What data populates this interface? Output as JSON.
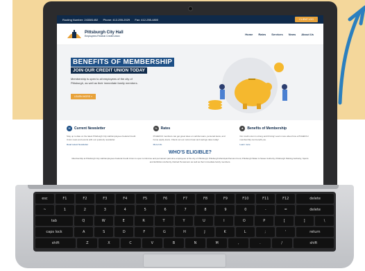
{
  "site": {
    "topbar": {
      "routing": "Routing Number: 243381452",
      "phone": "Phone: 412-255-2029",
      "fax": "Fax: 412-255-4800",
      "login_label": "CLIENT LOG"
    },
    "logo": {
      "line1": "Pittsburgh City Hall",
      "line2": "Employees Federal Credit Union"
    },
    "menu": [
      "Home",
      "Rates",
      "Services",
      "News",
      "About Us"
    ],
    "hero": {
      "title": "BENEFITS OF MEMBERSHIP",
      "subtitle": "JOIN OUR CREDIT UNION TODAY",
      "text": "Membership is open to all employees of the city of Pittsburgh, as well as their immediate family members.",
      "button": "LEARN MORE »"
    },
    "features": [
      {
        "icon": "newsletter-icon",
        "title": "Current Newsletter",
        "text": "Stay up to date on the latest Pittsburgh City Hall Employees Federal Credit Union news and events with our quarterly newsletter.",
        "link": "Read Latest Newsletter"
      },
      {
        "icon": "percent-icon",
        "title": "Rates",
        "text": "PCHEFCU members can get great rates on vehicle loans, personal loans, and home equity loans. Check out our current loan and savings rates today!",
        "link": "More Info"
      },
      {
        "icon": "membership-icon",
        "title": "Benefits of Membership",
        "text": "Our credit union is strong and thriving! Learn more about how a PCHEFCU membership can benefit you.",
        "link": "Learn more"
      }
    ],
    "eligible": {
      "title": "WHO'S ELIGIBLE?",
      "text": "Membership at Pittsburgh City Hall Employees Federal Credit Union is open to full-time and permanent part-time employees of the city of Pittsburgh, Pittsburgh Municipal Pension Fund, Pittsburgh Water & Sewer Authority, Pittsburgh Parking Authority, Sports and Exhibition Authority, Retired Pensioners as well as their immediate family members."
    }
  },
  "keyboard": {
    "row1": [
      "esc",
      "F1",
      "F2",
      "F3",
      "F4",
      "F5",
      "F6",
      "F7",
      "F8",
      "F9",
      "F10",
      "F11",
      "F12",
      "delete"
    ],
    "row2": [
      "~",
      "1",
      "2",
      "3",
      "4",
      "5",
      "6",
      "7",
      "8",
      "9",
      "0",
      "-",
      "=",
      "delete"
    ],
    "row3": [
      "tab",
      "Q",
      "W",
      "E",
      "R",
      "T",
      "Y",
      "U",
      "I",
      "O",
      "P",
      "[",
      "]",
      "\\"
    ],
    "row4": [
      "caps lock",
      "A",
      "S",
      "D",
      "F",
      "G",
      "H",
      "J",
      "K",
      "L",
      ";",
      "'",
      "return"
    ],
    "row5": [
      "shift",
      "Z",
      "X",
      "C",
      "V",
      "B",
      "N",
      "M",
      ",",
      ".",
      "/",
      "shift"
    ],
    "row6": [
      "fn",
      "ctrl",
      "alt",
      "cmd",
      "",
      "cmd",
      "alt",
      "◀",
      "▲▼",
      "▶"
    ]
  },
  "colors": {
    "navy": "#0f2a4a",
    "blue": "#1d4f86",
    "accent": "#e8a23a",
    "backdrop": "#f4d79b"
  }
}
